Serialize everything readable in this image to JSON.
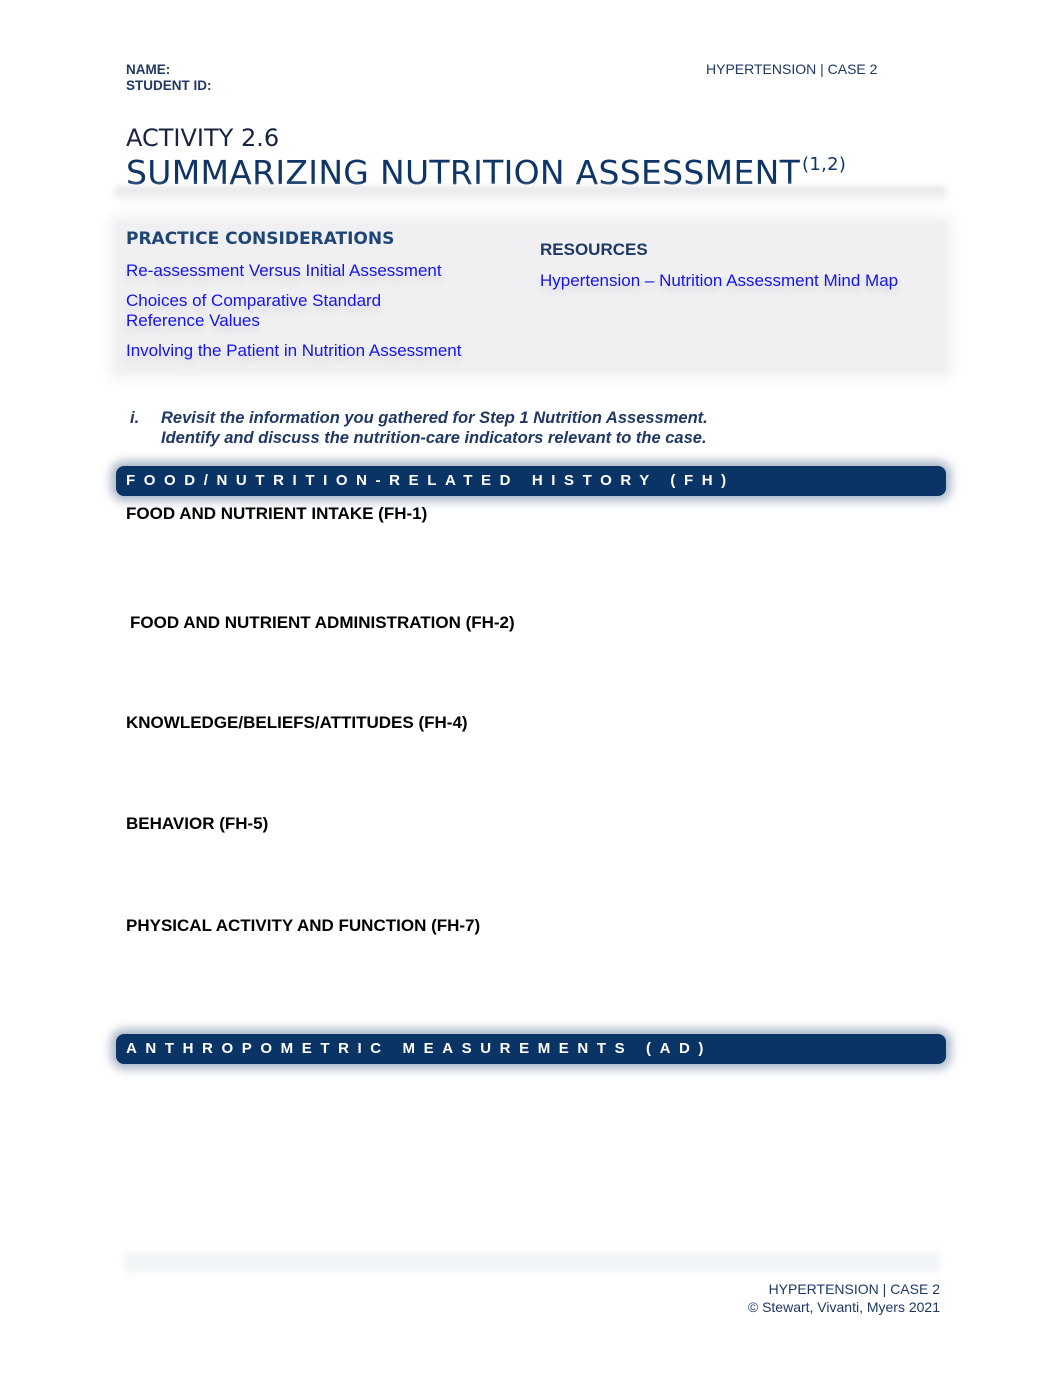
{
  "header": {
    "name_label": "NAME:",
    "student_id_label": "STUDENT ID:",
    "case_label": "HYPERTENSION | CASE 2"
  },
  "activity": {
    "number": "ACTIVITY 2.6",
    "title": "SUMMARIZING NUTRITION ASSESSMENT",
    "citation": "(1,2)"
  },
  "practice_considerations": {
    "heading": "PRACTICE CONSIDERATIONS",
    "links": [
      "Re-assessment Versus Initial Assessment",
      "Choices of Comparative Standard Reference Values",
      "Involving the Patient in Nutrition Assessment"
    ]
  },
  "resources": {
    "heading": "RESOURCES",
    "links": [
      "Hypertension – Nutrition Assessment Mind Map"
    ]
  },
  "instruction": {
    "number": "i.",
    "line1": "Revisit the information you gathered for Step 1 Nutrition Assessment.",
    "line2": "Identify and discuss the nutrition-care indicators relevant to the case."
  },
  "sections": [
    {
      "title": "FOOD/NUTRITION-RELATED HISTORY (FH)",
      "subsections": [
        "FOOD AND NUTRIENT INTAKE (FH-1)",
        "FOOD AND NUTRIENT ADMINISTRATION (FH-2)",
        "KNOWLEDGE/BELIEFS/ATTITUDES (FH-4)",
        "BEHAVIOR (FH-5)",
        "PHYSICAL ACTIVITY AND FUNCTION (FH-7)"
      ]
    },
    {
      "title": "ANTHROPOMETRIC MEASUREMENTS (AD)",
      "subsections": []
    }
  ],
  "footer": {
    "case_label": "HYPERTENSION | CASE 2",
    "copyright": "© Stewart, Vivanti, Myers 2021"
  },
  "colors": {
    "navy_band": "#0b3466",
    "title_blue": "#0e3566",
    "link_blue": "#1414f0",
    "heading_navy": "#1f3864"
  }
}
